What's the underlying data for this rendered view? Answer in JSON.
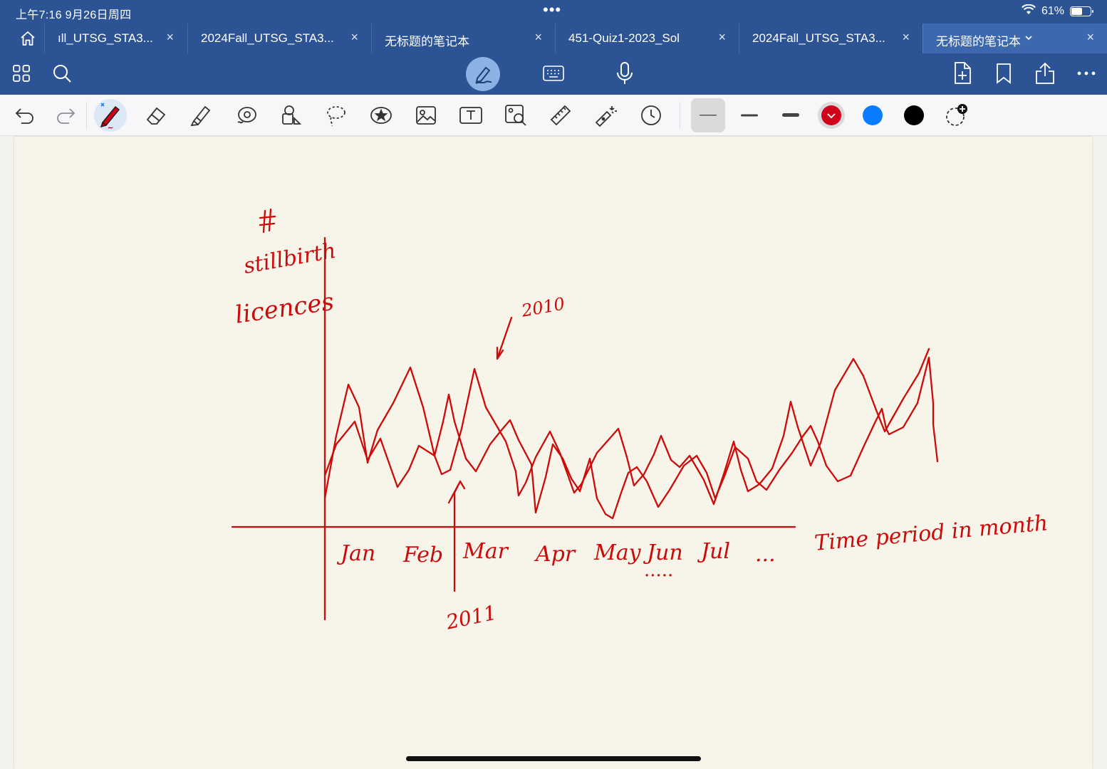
{
  "status": {
    "time": "上午7:16   9月26日周四",
    "dots": "•••",
    "battery_percent": "61%",
    "battery_level": 0.61
  },
  "tabs": [
    {
      "label": "ıll_UTSG_STA3...",
      "close": "×",
      "active": false
    },
    {
      "label": "2024Fall_UTSG_STA3...",
      "close": "×",
      "active": false
    },
    {
      "label": "无标题的笔记本",
      "close": "×",
      "active": false
    },
    {
      "label": "451-Quiz1-2023_Sol",
      "close": "×",
      "active": false
    },
    {
      "label": "2024Fall_UTSG_STA3...",
      "close": "×",
      "active": false
    },
    {
      "label": "无标题的笔记本",
      "close": "×",
      "active": true
    }
  ],
  "toolbar_top": {
    "left_icons": [
      "grid-icon",
      "search-icon"
    ],
    "center_icons": [
      "pencil-mode-icon",
      "keyboard-icon",
      "microphone-icon"
    ],
    "right_icons": [
      "add-page-icon",
      "bookmark-icon",
      "share-icon",
      "more-icon"
    ]
  },
  "tools": [
    "undo-icon",
    "redo-icon",
    "pen-icon",
    "eraser-icon",
    "highlighter-icon",
    "shape-icon",
    "elements-icon",
    "lasso-icon",
    "sticker-icon",
    "image-icon",
    "text-icon",
    "image-search-icon",
    "ruler-icon",
    "laser-pointer-icon",
    "clock-icon"
  ],
  "pen_thickness": [
    "thin",
    "medium",
    "thick"
  ],
  "pen_colors": {
    "red": "#d0021b",
    "blue": "#0a7cff",
    "black": "#000000"
  },
  "selected_color": "#d0021b",
  "accent_color": "#2c5393",
  "drawing": {
    "y_label_lines": [
      "#",
      "stillbirth",
      "licences"
    ],
    "x_label": "Time period in month",
    "months": [
      "Jan",
      "Feb",
      "Mar",
      "Apr",
      "May",
      "Jun",
      "Jul",
      "..."
    ],
    "annotation_2010": "2010",
    "annotation_2011": "2011",
    "jun_dots": "·····",
    "ink_color": "#cc0a0a"
  }
}
